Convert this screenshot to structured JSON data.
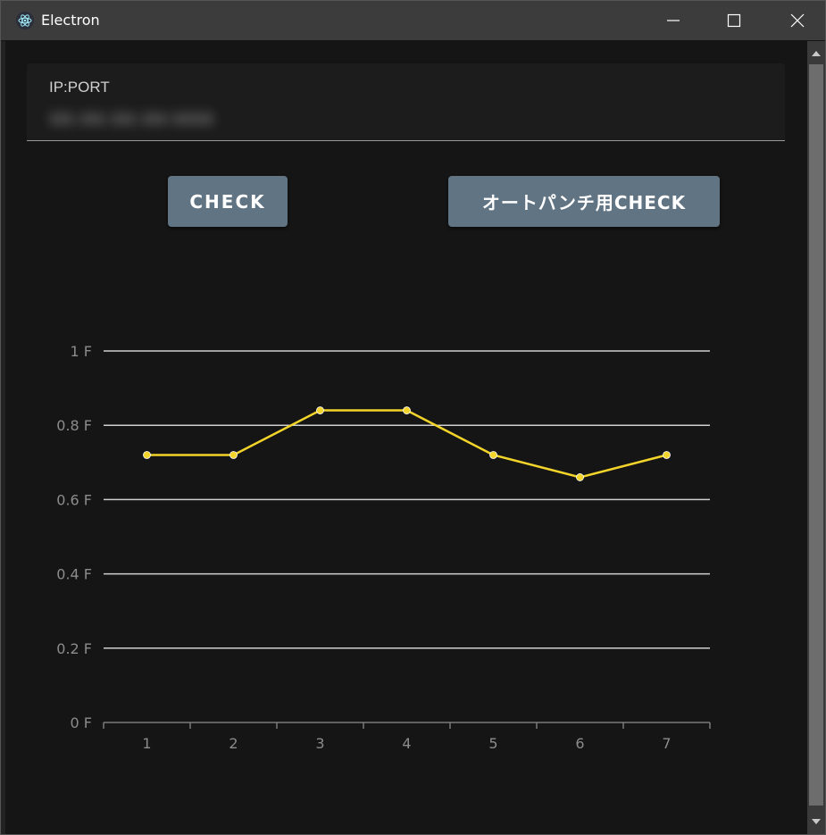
{
  "window": {
    "title": "Electron",
    "icon": "electron-atom-icon",
    "controls": [
      "minimize-icon",
      "maximize-icon",
      "close-icon"
    ]
  },
  "connection": {
    "label": "IP:PORT",
    "value": "111.111.111.111:11111"
  },
  "buttons": {
    "check_label": "CHECK",
    "autopunch_label": "オートパンチ用CHECK"
  },
  "colors": {
    "background": "#151515",
    "button": "#617483",
    "line": "#f2d42a",
    "grid": "#cfcfcf",
    "axis_text": "#8c8c8c"
  },
  "chart_data": {
    "type": "line",
    "x": [
      "1",
      "2",
      "3",
      "4",
      "5",
      "6",
      "7"
    ],
    "series": [
      {
        "values": [
          0.72,
          0.72,
          0.84,
          0.84,
          0.72,
          0.66,
          0.72
        ]
      }
    ],
    "ytick_labels": [
      "0 F",
      "0.2 F",
      "0.4 F",
      "0.6 F",
      "0.8 F",
      "1 F"
    ],
    "yticks": [
      0,
      0.2,
      0.4,
      0.6,
      0.8,
      1
    ],
    "ylim": [
      0,
      1
    ],
    "grid": true,
    "legend": "none"
  }
}
